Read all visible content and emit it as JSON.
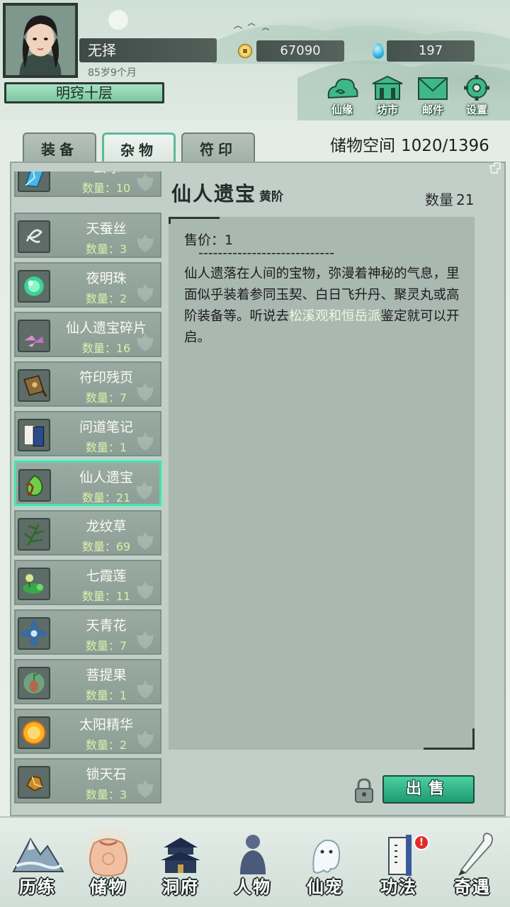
{
  "player": {
    "name": "无择",
    "age": "85岁9个月",
    "realm": "明窍十层",
    "coins": "67090",
    "gems": "197"
  },
  "top_buttons": [
    {
      "label": "仙缘",
      "icon": "cloud-icon"
    },
    {
      "label": "坊市",
      "icon": "market-icon"
    },
    {
      "label": "邮件",
      "icon": "mail-icon"
    },
    {
      "label": "设置",
      "icon": "gear-icon"
    }
  ],
  "tabs": [
    {
      "label": "装备",
      "active": false
    },
    {
      "label": "杂物",
      "active": true
    },
    {
      "label": "符印",
      "active": false
    }
  ],
  "storage": {
    "label": "储物空间",
    "value": "1020/1396"
  },
  "items": [
    {
      "name": "玄冰",
      "count": "数量：10",
      "icon": "ice-crystal-icon"
    },
    {
      "name": "天蚕丝",
      "count": "数量：3",
      "icon": "silk-icon"
    },
    {
      "name": "夜明珠",
      "count": "数量：2",
      "icon": "pearl-icon"
    },
    {
      "name": "仙人遗宝碎片",
      "count": "数量：16",
      "icon": "fragment-icon"
    },
    {
      "name": "符印残页",
      "count": "数量：7",
      "icon": "talisman-page-icon"
    },
    {
      "name": "问道笔记",
      "count": "数量：1",
      "icon": "notebook-icon"
    },
    {
      "name": "仙人遗宝",
      "count": "数量：21",
      "icon": "treasure-bag-icon",
      "selected": true
    },
    {
      "name": "龙纹草",
      "count": "数量：69",
      "icon": "herb-icon"
    },
    {
      "name": "七霞莲",
      "count": "数量：11",
      "icon": "lotus-icon"
    },
    {
      "name": "天青花",
      "count": "数量：7",
      "icon": "flower-icon"
    },
    {
      "name": "菩提果",
      "count": "数量：1",
      "icon": "fruit-icon"
    },
    {
      "name": "太阳精华",
      "count": "数量：2",
      "icon": "sun-orb-icon"
    },
    {
      "name": "锁天石",
      "count": "数量：3",
      "icon": "stone-icon"
    }
  ],
  "detail": {
    "title": "仙人遗宝",
    "grade": "黄阶",
    "quantity_label": "数量",
    "quantity": "21",
    "price": "售价：1",
    "divider": "----------------------------",
    "desc_part1": "仙人遗落在人间的宝物，弥漫着神秘的气息，里面似乎装着参同玉契、白日飞升丹、聚灵丸或高阶装备等。听说去",
    "desc_hl1": "松溪观和",
    "desc_hl2": "恒岳派",
    "desc_part2": "鉴定就可以开启。",
    "sell_label": "出售"
  },
  "bottom_nav": [
    {
      "label": "历练",
      "icon": "mountain-icon"
    },
    {
      "label": "储物",
      "icon": "bag-icon",
      "active": true
    },
    {
      "label": "洞府",
      "icon": "pagoda-icon"
    },
    {
      "label": "人物",
      "icon": "person-icon"
    },
    {
      "label": "仙宠",
      "icon": "ghost-pet-icon"
    },
    {
      "label": "功法",
      "icon": "scroll-icon",
      "badge": "!"
    },
    {
      "label": "奇遇",
      "icon": "brush-icon"
    }
  ],
  "colors": {
    "accent": "#4be0b0",
    "panel": "#c2cfc9",
    "highlight_text": "#e8fbe0",
    "badge": "#e32a2a"
  }
}
